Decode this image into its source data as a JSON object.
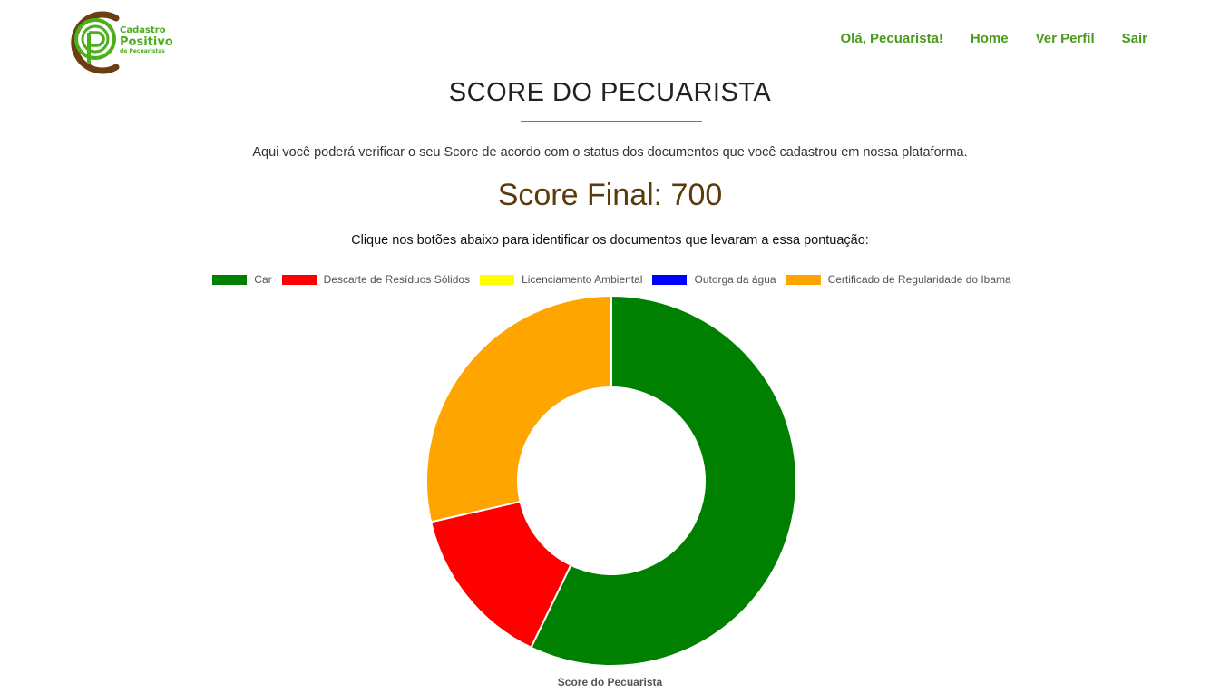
{
  "brand": {
    "line1": "Cadastro",
    "line2": "Positivo",
    "line3": "de Pecuaristas",
    "logo_colors": {
      "brown": "#6b3e12",
      "green": "#4caf1c"
    }
  },
  "nav": {
    "greeting": "Olá, Pecuarista!",
    "home": "Home",
    "profile": "Ver Perfil",
    "logout": "Sair"
  },
  "page": {
    "title": "SCORE DO PECUARISTA",
    "intro": "Aqui você poderá verificar o seu Score de acordo com o status dos documentos que você cadastrou em nossa plataforma.",
    "score_text": "Score Final: 700",
    "instruction": "Clique nos botões abaixo para identificar os documentos que levaram a essa pontuação:"
  },
  "chart_data": {
    "type": "pie",
    "variant": "doughnut",
    "title": "Score do Pecuarista",
    "legend_position": "top",
    "categories": [
      "Car",
      "Descarte de Resíduos Sólidos",
      "Licenciamento Ambiental",
      "Outorga da água",
      "Certificado de Regularidade do Ibama"
    ],
    "values": [
      400,
      100,
      0,
      0,
      200
    ],
    "colors": [
      "#008000",
      "#ff0000",
      "#ffff00",
      "#0000ff",
      "#ffa500"
    ]
  }
}
